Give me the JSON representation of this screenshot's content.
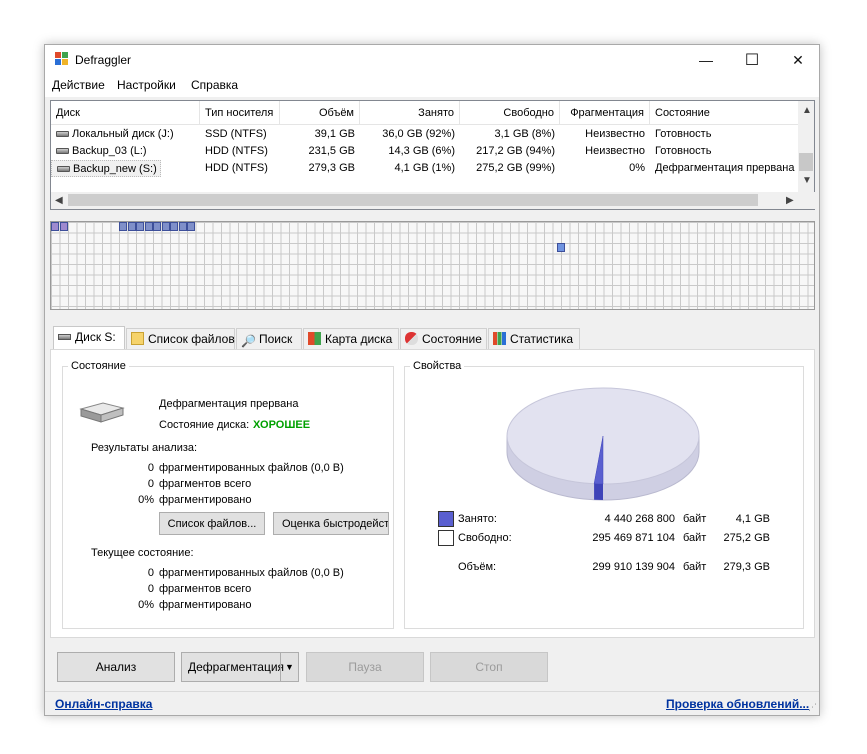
{
  "window": {
    "title": "Defraggler",
    "controls": {
      "minimize": "—",
      "maximize": "☐",
      "close": "✕"
    }
  },
  "menu": [
    "Действие",
    "Настройки",
    "Справка"
  ],
  "disk_list": {
    "columns": [
      "Диск",
      "Тип носителя",
      "Объём",
      "Занято",
      "Свободно",
      "Фрагментация",
      "Состояние"
    ],
    "rows": [
      [
        "Локальный диск (J:)",
        "SSD (NTFS)",
        "39,1 GB",
        "36,0 GB (92%)",
        "3,1 GB (8%)",
        "Неизвестно",
        "Готовность"
      ],
      [
        "Backup_03 (L:)",
        "HDD (NTFS)",
        "231,5 GB",
        "14,3 GB (6%)",
        "217,2 GB (94%)",
        "Неизвестно",
        "Готовность"
      ],
      [
        "Backup_new (S:)",
        "HDD (NTFS)",
        "279,3 GB",
        "4,1 GB (1%)",
        "275,2 GB (99%)",
        "0%",
        "Дефрагментация прервана"
      ]
    ]
  },
  "tabs": [
    "Диск S:",
    "Список файлов",
    "Поиск",
    "Карта диска",
    "Состояние",
    "Статистика"
  ],
  "status": {
    "legend": "Состояние",
    "message": "Дефрагментация прервана",
    "health_label": "Состояние диска:",
    "health_value": "ХОРОШЕЕ",
    "health_color": "#00a000",
    "analysis_title": "Результаты анализа:",
    "analysis": [
      {
        "value": "0",
        "label": "фрагментированных файлов (0,0 B)"
      },
      {
        "value": "0",
        "label": "фрагментов всего"
      },
      {
        "value": "0%",
        "label": "фрагментировано"
      }
    ],
    "file_list_button": "Список файлов...",
    "benchmark_button": "Оценка быстродействия",
    "current_title": "Текущее состояние:",
    "current": [
      {
        "value": "0",
        "label": "фрагментированных файлов (0,0 B)"
      },
      {
        "value": "0",
        "label": "фрагментов всего"
      },
      {
        "value": "0%",
        "label": "фрагментировано"
      }
    ]
  },
  "properties": {
    "legend": "Свойства",
    "used_fraction": 0.0148,
    "used_color": "#5a5fd0",
    "free_color": "#dcdcee",
    "rows": [
      {
        "label": "Занято:",
        "bytes": "4 440 268 800",
        "unit": "байт",
        "size": "4,1 GB"
      },
      {
        "label": "Свободно:",
        "bytes": "295 469 871 104",
        "unit": "байт",
        "size": "275,2 GB"
      },
      {
        "label": "Объём:",
        "bytes": "299 910 139 904",
        "unit": "байт",
        "size": "279,3 GB"
      }
    ]
  },
  "actions": {
    "analyze": "Анализ",
    "defrag": "Дефрагментация",
    "pause": "Пауза",
    "stop": "Стоп"
  },
  "footer": {
    "help_link": "Онлайн-справка",
    "update_link": "Проверка обновлений..."
  }
}
